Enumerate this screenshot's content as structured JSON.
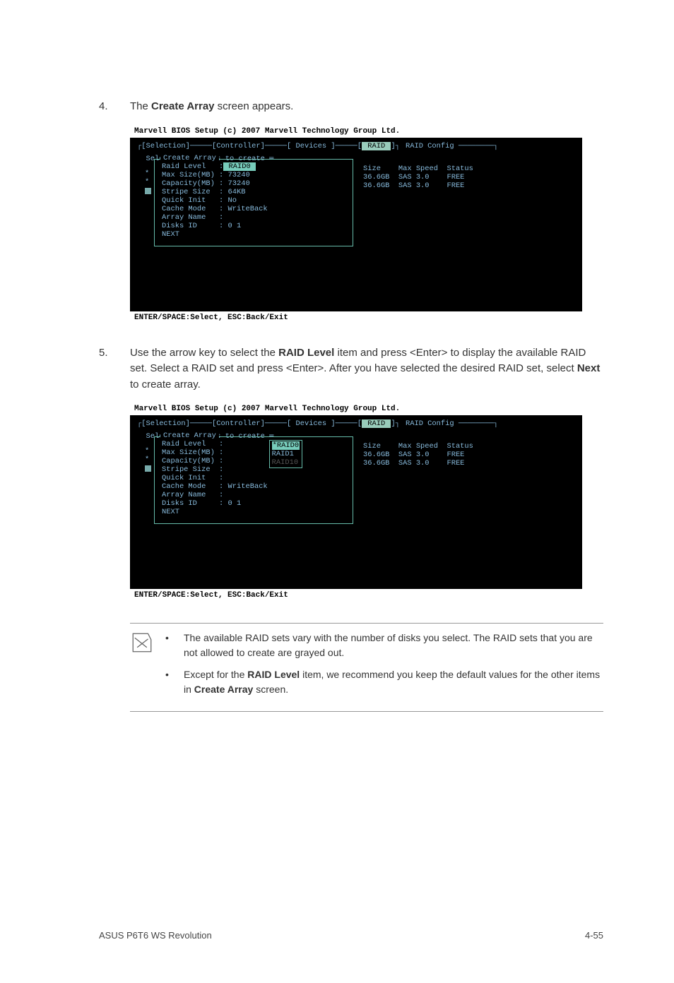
{
  "steps": {
    "s4_num": "4.",
    "s4_text_pre": "The ",
    "s4_text_bold": "Create Array",
    "s4_text_post": " screen appears.",
    "s5_num": "5.",
    "s5_text_pre": "Use the arrow key to select the ",
    "s5_bold1": "RAID Level",
    "s5_mid1": " item and press <Enter> to display the available RAID set. Select a RAID set and press <Enter>. After you have selected the desired RAID set, select ",
    "s5_bold2": "Next",
    "s5_post": " to create array."
  },
  "bios": {
    "title": "Marvell BIOS Setup (c) 2007 Marvell Technology Group Ltd.",
    "tabs_line_pre": "[Selection]─────[Controller]─────[ Devices ]─────[",
    "tabs_raid": " RAID ",
    "tabs_line_post": "]",
    "raid_config": "RAID Config ────────┐",
    "select_line": "Select free disks to create ═",
    "create_title": "Create Array",
    "status_bar": "ENTER/SPACE:Select, ESC:Back/Exit"
  },
  "panel1": {
    "raid_level_label": "Raid Level   :",
    "raid_level_value": " RAID0 ",
    "max_size": "Max Size(MB) : 73240",
    "capacity": "Capacity(MB) : 73240",
    "stripe": "Stripe Size  : 64KB",
    "quick": "Quick Init   : No",
    "cache": "Cache Mode   : WriteBack",
    "arrayname": "Array Name   :",
    "disks": "Disks ID     : 0 1",
    "next": "NEXT"
  },
  "panel2": {
    "raid_level_label": "Raid Level   :",
    "opt_raid0": "*RAID0",
    "opt_raid1": " RAID1",
    "opt_raid10": " RAID10",
    "max_size": "Max Size(MB) :",
    "capacity": "Capacity(MB) :",
    "stripe": "Stripe Size  :",
    "quick": "Quick Init   :",
    "cache": "Cache Mode   : WriteBack",
    "arrayname": "Array Name   :",
    "disks": "Disks ID     : 0 1",
    "next": "NEXT"
  },
  "right_table": {
    "header": "Size    Max Speed  Status",
    "row1": "36.6GB  SAS 3.0    FREE",
    "row2": "36.6GB  SAS 3.0    FREE"
  },
  "notes": {
    "n1": "The available RAID sets vary with the number of disks you select. The RAID sets that you are not allowed to create are grayed out.",
    "n2_pre": "Except for the ",
    "n2_bold1": "RAID Level",
    "n2_mid": " item, we recommend you keep the default values for the other items in ",
    "n2_bold2": "Create Array",
    "n2_post": " screen."
  },
  "footer": {
    "left": "ASUS P6T6 WS Revolution",
    "right": "4-55"
  }
}
